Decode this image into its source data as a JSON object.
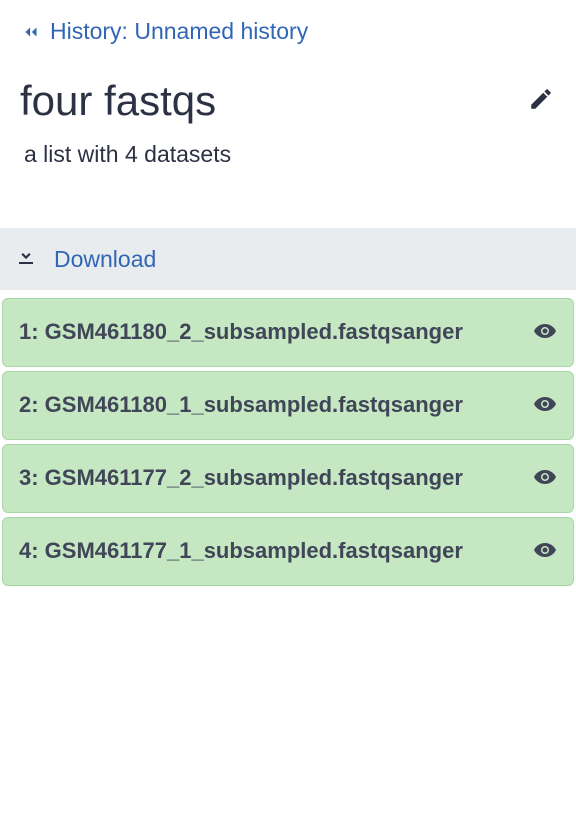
{
  "breadcrumb": {
    "label": "History: Unnamed history"
  },
  "title": "four fastqs",
  "subtitle": "a list with 4 datasets",
  "download": {
    "label": "Download"
  },
  "datasets": [
    {
      "label": "1: GSM461180_2_subsampled.fastqsanger"
    },
    {
      "label": "2: GSM461180_1_subsampled.fastqsanger"
    },
    {
      "label": "3: GSM461177_2_subsampled.fastqsanger"
    },
    {
      "label": "4: GSM461177_1_subsampled.fastqsanger"
    }
  ]
}
